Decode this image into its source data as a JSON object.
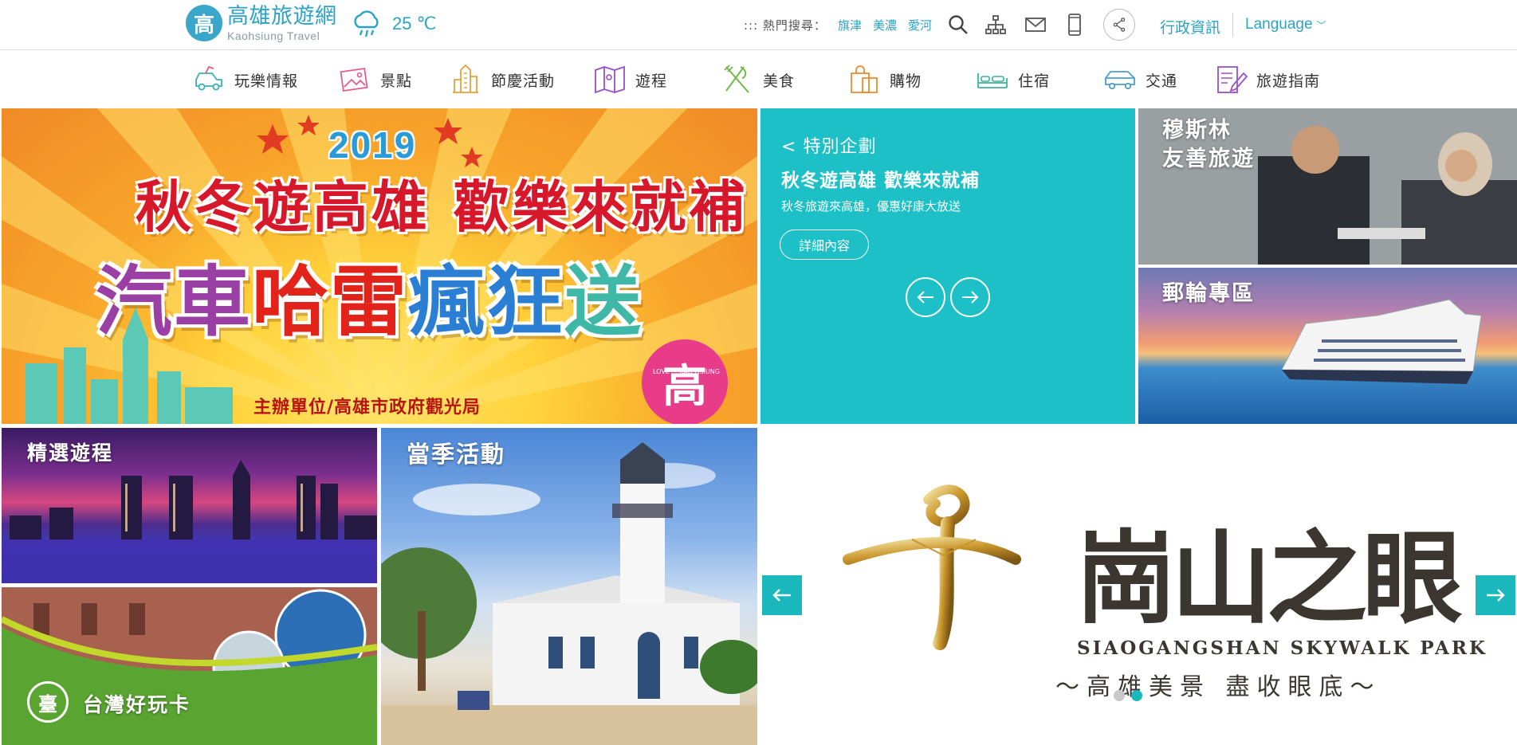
{
  "header": {
    "logo_zh": "高雄旅遊網",
    "logo_en": "Kaohsiung Travel",
    "logo_mark": "高",
    "weather_icon": "rain-cloud-icon",
    "temperature": "25 ℃",
    "hot_search_label": "::: 熱門搜尋：",
    "hot_links": [
      "旗津",
      "美濃",
      "愛河"
    ],
    "gov_info": "行政資訊",
    "language": "Language"
  },
  "nav": [
    {
      "label": "玩樂情報",
      "icon": "car-icon"
    },
    {
      "label": "景點",
      "icon": "picture-icon"
    },
    {
      "label": "節慶活動",
      "icon": "building-icon"
    },
    {
      "label": "遊程",
      "icon": "map-icon"
    },
    {
      "label": "美食",
      "icon": "fork-knife-icon"
    },
    {
      "label": "購物",
      "icon": "shopping-bag-icon"
    },
    {
      "label": "住宿",
      "icon": "bed-icon"
    },
    {
      "label": "交通",
      "icon": "vehicle-icon"
    },
    {
      "label": "旅遊指南",
      "icon": "notepad-icon"
    }
  ],
  "banner": {
    "year": "2019",
    "line1": "秋冬遊高雄 歡樂來就補",
    "line2_a": "汽車",
    "line2_b": "哈雷",
    "line2_c": "瘋",
    "line2_d": "狂",
    "line2_e": "送",
    "organizer": "主辦單位/高雄市政府觀光局",
    "badge_mark": "高",
    "badge_left": "LOVE",
    "badge_right": "KAO HSIUNG"
  },
  "special": {
    "heading": "特別企劃",
    "back_glyph": "<",
    "title": "秋冬遊高雄 歡樂來就補",
    "desc": "秋冬旅遊來高雄，優惠好康大放送",
    "button": "詳細內容"
  },
  "tiles": {
    "muslim": "穆斯林\n友善旅遊",
    "muslim_l1": "穆斯林",
    "muslim_l2": "友善旅遊",
    "cruise": "郵輪專區",
    "tours": "精選遊程",
    "season": "當季活動",
    "taiwan_pass": "台灣好玩卡"
  },
  "slideshow": {
    "logo_zh": "崗山之眼",
    "logo_en": "SIAOGANGSHAN SKYWALK PARK",
    "tagline": "～高雄美景 盡收眼底～",
    "active_dot": 1,
    "dot_count": 2
  },
  "colors": {
    "accent": "#2ba3c6",
    "teal_panel": "#1cc0c6",
    "slide_nav": "#1ab7bd"
  }
}
